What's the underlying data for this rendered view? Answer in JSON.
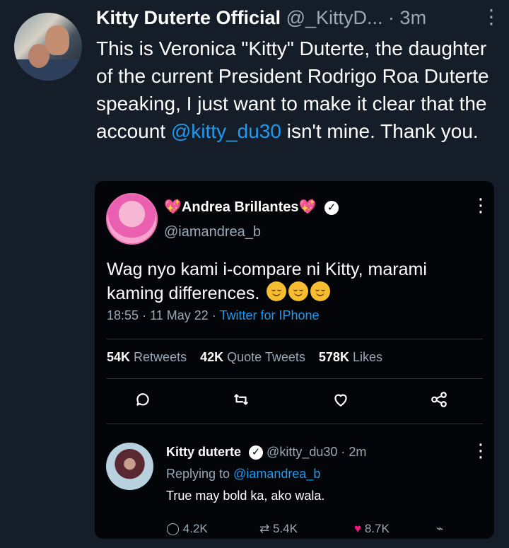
{
  "tweet": {
    "name": "Kitty Duterte Official",
    "handle": "@_KittyD...",
    "separator": "·",
    "time": "3m",
    "text_parts": [
      "This is Veronica \"Kitty\" Duterte, the daughter of the current President Rodrigo Roa Duterte speaking, I just want to make it clear that the account ",
      "@kitty_du30",
      " isn't mine. Thank you."
    ]
  },
  "quoted": {
    "name": "Andrea Brillantes",
    "name_decor": "💖",
    "handle": "@iamandrea_b",
    "text": "Wag nyo kami i-compare ni Kitty, marami kaming differences.",
    "time": "18:55",
    "date": "11 May 22",
    "source": "Twitter for IPhone",
    "stats": [
      {
        "value": "54K",
        "label": "Retweets"
      },
      {
        "value": "42K",
        "label": "Quote Tweets"
      },
      {
        "value": "578K",
        "label": "Likes"
      }
    ]
  },
  "reply": {
    "name": "Kitty duterte",
    "handle": "@kitty_du30",
    "time": "2m",
    "replying_to_label": "Replying to",
    "replying_to": "@iamandrea_b",
    "text": "True may bold ka, ako wala.",
    "counts": {
      "reply": "4.2K",
      "retweet": "5.4K",
      "like": "8.7K"
    }
  },
  "icons": {
    "more": "more-vertical-icon",
    "reply": "reply-icon",
    "retweet": "retweet-icon",
    "like": "heart-icon",
    "share": "share-icon",
    "verified": "verified-badge-icon"
  },
  "colors": {
    "background": "#151d29",
    "card_background": "#030508",
    "accent": "#1d9bf0",
    "muted": "#9aa9b7",
    "like": "#f91880"
  }
}
